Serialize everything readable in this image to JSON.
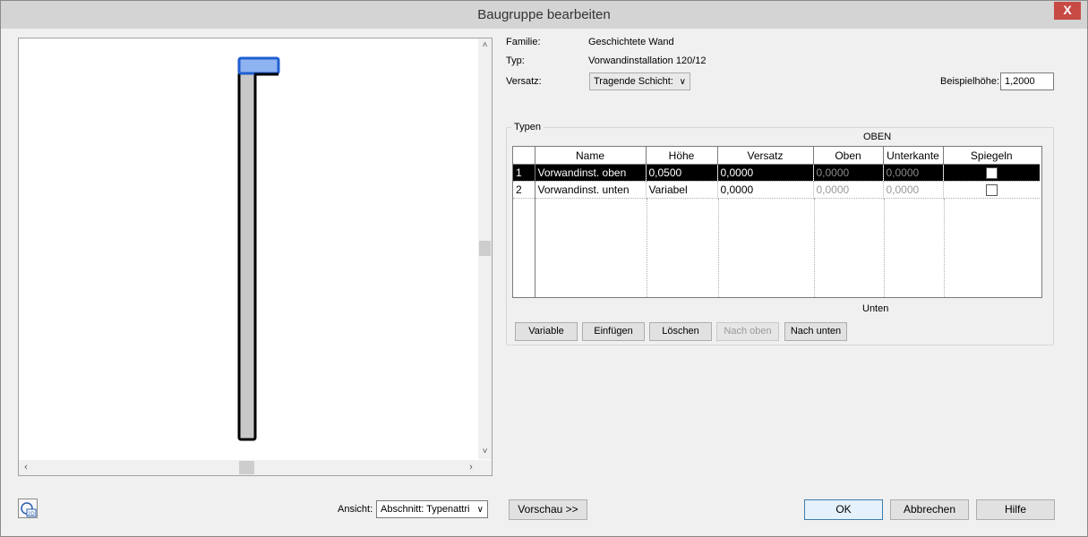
{
  "window": {
    "title": "Baugruppe bearbeiten",
    "close_label": "X"
  },
  "info": {
    "familie_label": "Familie:",
    "familie_value": "Geschichtete Wand",
    "typ_label": "Typ:",
    "typ_value": "Vorwandinstallation 120/12",
    "versatz_label": "Versatz:",
    "versatz_value": "Tragende Schicht:",
    "beispielhoehe_label": "Beispielhöhe:",
    "beispielhoehe_value": "1,2000"
  },
  "types": {
    "legend": "Typen",
    "top_label": "OBEN",
    "bottom_label": "Unten",
    "columns": [
      "",
      "Name",
      "Höhe",
      "Versatz",
      "Oben",
      "Unterkante",
      "Spiegeln"
    ],
    "rows": [
      {
        "num": "1",
        "name": "Vorwandinst. oben",
        "hoehe": "0,0500",
        "versatz": "0,0000",
        "oben": "0,0000",
        "unterkante": "0,0000",
        "spiegeln": false,
        "selected": true
      },
      {
        "num": "2",
        "name": "Vorwandinst. unten",
        "hoehe": "Variabel",
        "versatz": "0,0000",
        "oben": "0,0000",
        "unterkante": "0,0000",
        "spiegeln": false,
        "selected": false
      }
    ]
  },
  "buttons": {
    "variable": "Variable",
    "einfuegen": "Einfügen",
    "loeschen": "Löschen",
    "nach_oben": "Nach oben",
    "nach_unten": "Nach unten",
    "vorschau": "Vorschau >>",
    "ok": "OK",
    "abbrechen": "Abbrechen",
    "hilfe": "Hilfe"
  },
  "view": {
    "ansicht_label": "Ansicht:",
    "ansicht_value": "Abschnitt: Typenattri"
  },
  "colors": {
    "selection_blue": "#1f5fd1",
    "selection_fill": "#8fb3f0",
    "wall_fill": "#c8c8c8"
  }
}
